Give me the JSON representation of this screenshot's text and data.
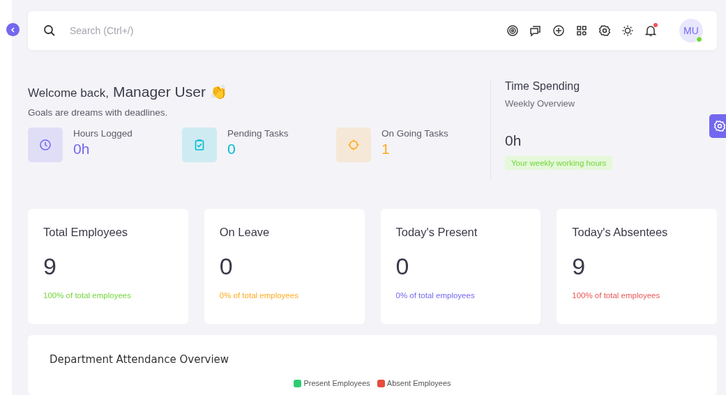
{
  "navbar": {
    "search": {
      "placeholder": "Search (Ctrl+/)"
    },
    "actions": [
      {
        "kind": "target",
        "badge": false
      },
      {
        "kind": "chat",
        "badge": false
      },
      {
        "kind": "add",
        "badge": false
      },
      {
        "kind": "apps",
        "badge": false
      },
      {
        "kind": "settings",
        "badge": false
      },
      {
        "kind": "theme",
        "badge": false
      },
      {
        "kind": "notifications",
        "badge": true
      }
    ],
    "avatar": {
      "initials": "MU",
      "online": true
    }
  },
  "welcome": {
    "greeting": "Welcome back,",
    "name": "Manager User",
    "emoji": "👏",
    "quote": "Goals are dreams with deadlines.",
    "stats": [
      {
        "kind": "clock",
        "label": "Hours Logged",
        "value": "0h",
        "color": "#7367f0"
      },
      {
        "kind": "task",
        "label": "Pending Tasks",
        "value": "0",
        "color": "#00bad1"
      },
      {
        "kind": "progress",
        "label": "On Going Tasks",
        "value": "1",
        "color": "#ffab1d"
      }
    ]
  },
  "time_spending": {
    "title": "Time Spending",
    "subtitle": "Weekly Overview",
    "value": "0h",
    "badge": "Your weekly working hours"
  },
  "cards": [
    {
      "title": "Total Employees",
      "value": "9",
      "note": "100% of total employees",
      "color": "#72d63a"
    },
    {
      "title": "On Leave",
      "value": "0",
      "note": "0% of total employees",
      "color": "#ffab1d"
    },
    {
      "title": "Today's Present",
      "value": "0",
      "note": "0% of total employees",
      "color": "#7367f0"
    },
    {
      "title": "Today's Absentees",
      "value": "9",
      "note": "100% of total employees",
      "color": "#ea5455"
    }
  ],
  "attendance": {
    "title": "Department Attendance Overview",
    "legend": [
      {
        "name": "Present Employees",
        "color": "#2ecc71"
      },
      {
        "name": "Absent Employees",
        "color": "#e74c3c"
      }
    ]
  }
}
